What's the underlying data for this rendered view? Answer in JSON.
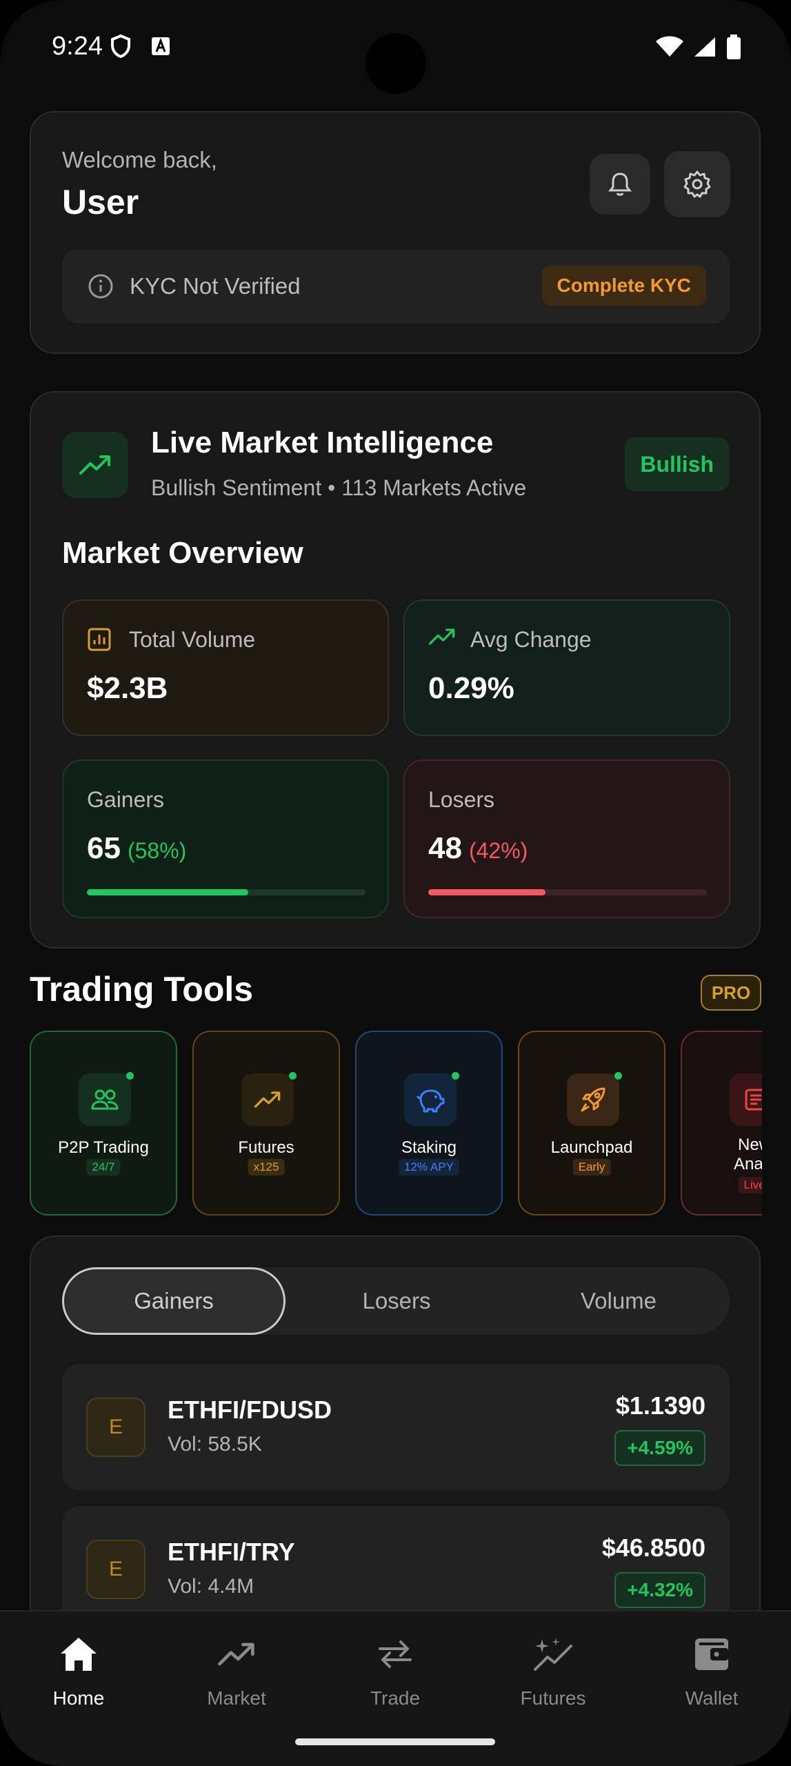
{
  "status_bar": {
    "time": "9:24"
  },
  "welcome": {
    "greeting": "Welcome back,",
    "name": "User",
    "kyc_status": "KYC Not Verified",
    "kyc_button": "Complete KYC"
  },
  "market": {
    "title": "Live Market Intelligence",
    "subtitle": "Bullish Sentiment • 113 Markets Active",
    "sentiment_badge": "Bullish",
    "overview_title": "Market Overview",
    "total_volume": {
      "label": "Total Volume",
      "value": "$2.3B"
    },
    "avg_change": {
      "label": "Avg Change",
      "value": "0.29%"
    },
    "gainers": {
      "label": "Gainers",
      "count": "65",
      "pct": "(58%)",
      "fraction": 0.58
    },
    "losers": {
      "label": "Losers",
      "count": "48",
      "pct": "(42%)",
      "fraction": 0.42
    }
  },
  "trading_tools": {
    "title": "Trading Tools",
    "badge": "PRO",
    "items": [
      {
        "name": "P2P Trading",
        "tag": "24/7",
        "icon": "users-icon",
        "accent": "#22c55e"
      },
      {
        "name": "Futures",
        "tag": "x125",
        "icon": "trending-up-icon",
        "accent": "#d89f2a"
      },
      {
        "name": "Staking",
        "tag": "12% APY",
        "icon": "piggy-bank-icon",
        "accent": "#3b82f6"
      },
      {
        "name": "Launchpad",
        "tag": "Early",
        "icon": "rocket-icon",
        "accent": "#f59a2f"
      },
      {
        "name": "News Analysis",
        "name_visible": "New\nAnaly",
        "tag": "Live",
        "icon": "newspaper-icon",
        "accent": "#ef4444"
      }
    ]
  },
  "movers": {
    "tabs": [
      "Gainers",
      "Losers",
      "Volume"
    ],
    "active_tab": "Gainers",
    "rows": [
      {
        "coin": "E",
        "pair": "ETHFI/FDUSD",
        "volume": "Vol: 58.5K",
        "price": "$1.1390",
        "change": "+4.59%"
      },
      {
        "coin": "E",
        "pair": "ETHFI/TRY",
        "volume": "Vol: 4.4M",
        "price": "$46.8500",
        "change": "+4.32%"
      }
    ]
  },
  "nav": {
    "items": [
      {
        "label": "Home",
        "icon": "home-icon",
        "active": true
      },
      {
        "label": "Market",
        "icon": "trending-up-icon",
        "active": false
      },
      {
        "label": "Trade",
        "icon": "swap-icon",
        "active": false
      },
      {
        "label": "Futures",
        "icon": "sparkle-chart-icon",
        "active": false
      },
      {
        "label": "Wallet",
        "icon": "wallet-icon",
        "active": false
      }
    ]
  },
  "colors": {
    "background": "#0c0c0c",
    "card": "#181818",
    "green": "#22c55e",
    "red": "#f05a60",
    "orange": "#f59a2f",
    "gold": "#d89f2a"
  }
}
